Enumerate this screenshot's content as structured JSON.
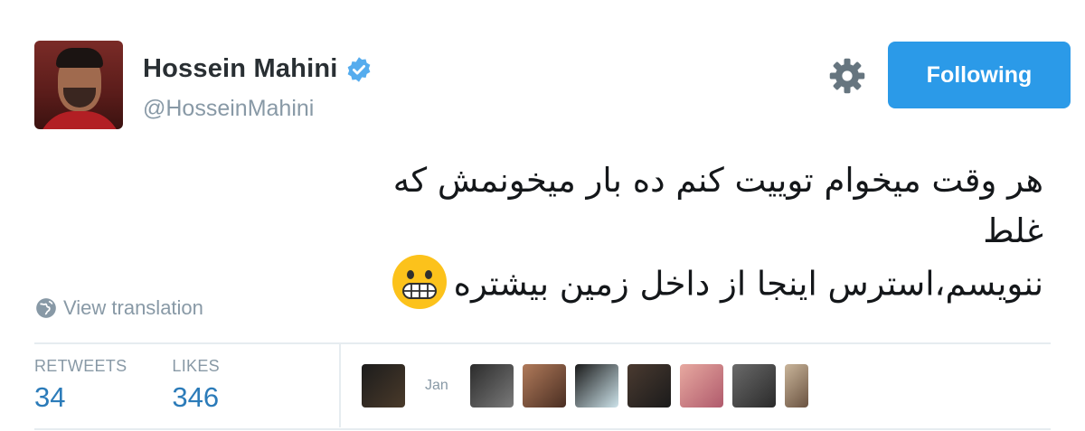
{
  "profile": {
    "name": "Hossein Mahini",
    "handle": "@HosseinMahini",
    "verified": true,
    "follow_label": "Following",
    "settings_icon": "gear-icon",
    "verified_icon": "verified-badge-icon"
  },
  "tweet": {
    "line1": "هر وقت میخوام توییت کنم ده بار میخونمش که غلط",
    "line2": "ننویسم،استرس اینجا از داخل زمین بیشتره",
    "emoji": "grimacing-face-emoji",
    "translate_label": "View translation",
    "translate_icon": "globe-icon"
  },
  "stats": {
    "retweets_label": "RETWEETS",
    "retweets": "34",
    "likes_label": "LIKES",
    "likes": "346"
  },
  "likers": {
    "caption": "Jan",
    "avatars": [
      "liker-1",
      "liker-2",
      "liker-3",
      "liker-4",
      "liker-5",
      "liker-6",
      "liker-7",
      "liker-8",
      "liker-9"
    ]
  },
  "colors": {
    "accent": "#2b9ae8",
    "link": "#2b7bb9",
    "muted": "#8899a6",
    "text": "#292f33"
  }
}
